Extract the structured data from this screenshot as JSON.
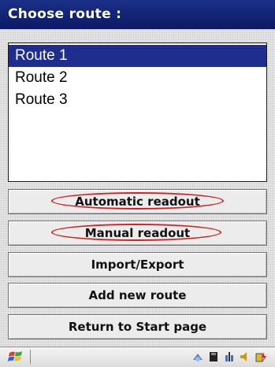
{
  "title": "Choose route :",
  "routes": [
    {
      "label": "Route 1",
      "selected": true
    },
    {
      "label": "Route 2",
      "selected": false
    },
    {
      "label": "Route 3",
      "selected": false
    }
  ],
  "buttons": {
    "automatic_readout": "Automatic readout",
    "manual_readout": "Manual readout",
    "import_export": "Import/Export",
    "add_new_route": "Add new route",
    "return_to_start": "Return to Start page"
  },
  "colors": {
    "title_bg": "#1a2f86",
    "selection": "#1f2d8f",
    "annotation": "#d42020"
  },
  "taskbar": {
    "start_icon": "windows-flag-icon",
    "tray_icons": [
      "connectivity-icon",
      "memory-card-icon",
      "network-icon",
      "speaker-icon",
      "battery-charging-icon"
    ]
  }
}
